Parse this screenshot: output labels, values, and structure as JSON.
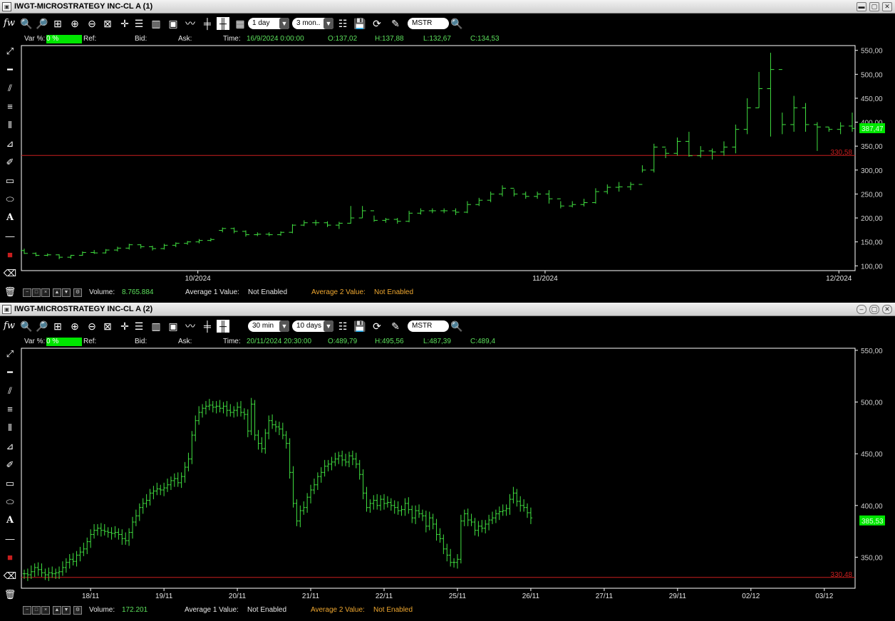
{
  "colors": {
    "bar": "#40e040",
    "price_line": "#c81e1e",
    "price_label": "#c81e1e",
    "last_box": "#00e600",
    "frame": "#ffffff"
  },
  "panes": [
    {
      "title": "IWGT-MICROSTRATEGY INC-CL A (1)",
      "toolbar": {
        "fw_label": "fw",
        "interval": "1 day",
        "range": "3 mon..",
        "symbol": "MSTR"
      },
      "info": {
        "var_label": "Var %:",
        "var_value": "0 %",
        "ref_label": "Ref:",
        "bid_label": "Bid:",
        "ask_label": "Ask:",
        "time_label": "Time:",
        "time_value": "16/9/2024 0:00:00",
        "open": "O:137,02",
        "high": "H:137,88",
        "low": "L:132,67",
        "close": "C:134,53"
      },
      "status": {
        "volume_label": "Volume:",
        "volume_value": "8.765.884",
        "avg1_label": "Average 1 Value:",
        "avg1_value": "Not Enabled",
        "avg2_label": "Average 2 Value:",
        "avg2_value": "Not Enabled"
      },
      "chart_data": {
        "type": "ohlc",
        "y_ticks": [
          "550,00",
          "500,00",
          "450,00",
          "400,00",
          "350,00",
          "300,00",
          "250,00",
          "200,00",
          "150,00",
          "100,00"
        ],
        "ylim": [
          90,
          560
        ],
        "x_labels": [
          "10/2024",
          "11/2024",
          "12/2024"
        ],
        "x_label_index": [
          13,
          39,
          61
        ],
        "x_count": 63,
        "price_line": {
          "value": 330.58,
          "label": "330,58"
        },
        "last_value": {
          "value": 387.47,
          "label": "387,47"
        },
        "bars": [
          [
            132,
            126,
            136,
            125
          ],
          [
            126,
            122,
            128,
            120
          ],
          [
            122,
            123,
            126,
            120
          ],
          [
            123,
            118,
            124,
            114
          ],
          [
            118,
            122,
            123,
            115
          ],
          [
            122,
            128,
            130,
            121
          ],
          [
            128,
            127,
            133,
            125
          ],
          [
            127,
            133,
            135,
            126
          ],
          [
            133,
            137,
            140,
            130
          ],
          [
            137,
            144,
            146,
            134
          ],
          [
            144,
            140,
            145,
            136
          ],
          [
            140,
            136,
            142,
            132
          ],
          [
            136,
            143,
            146,
            134
          ],
          [
            143,
            147,
            149,
            139
          ],
          [
            147,
            150,
            152,
            144
          ],
          [
            150,
            153,
            156,
            147
          ],
          [
            153,
            155,
            158,
            151
          ],
          [
            174,
            178,
            180,
            170
          ],
          [
            178,
            172,
            180,
            168
          ],
          [
            172,
            165,
            174,
            161
          ],
          [
            165,
            166,
            170,
            162
          ],
          [
            166,
            165,
            170,
            162
          ],
          [
            165,
            170,
            172,
            163
          ],
          [
            170,
            185,
            187,
            168
          ],
          [
            185,
            190,
            195,
            183
          ],
          [
            190,
            190,
            196,
            184
          ],
          [
            190,
            185,
            193,
            181
          ],
          [
            185,
            189,
            192,
            177
          ],
          [
            189,
            200,
            225,
            188
          ],
          [
            200,
            215,
            225,
            200
          ],
          [
            215,
            195,
            205,
            192
          ],
          [
            195,
            197,
            200,
            190
          ],
          [
            197,
            193,
            200,
            188
          ],
          [
            193,
            210,
            215,
            191
          ],
          [
            210,
            215,
            220,
            207
          ],
          [
            215,
            215,
            220,
            210
          ],
          [
            215,
            215,
            220,
            210
          ],
          [
            215,
            212,
            220,
            206
          ],
          [
            212,
            228,
            235,
            210
          ],
          [
            228,
            237,
            242,
            225
          ],
          [
            237,
            250,
            255,
            233
          ],
          [
            250,
            262,
            268,
            245
          ],
          [
            262,
            250,
            260,
            245
          ],
          [
            250,
            245,
            255,
            240
          ],
          [
            245,
            250,
            255,
            240
          ],
          [
            250,
            240,
            258,
            230
          ],
          [
            240,
            225,
            235,
            220
          ],
          [
            225,
            228,
            235,
            222
          ],
          [
            228,
            232,
            240,
            224
          ],
          [
            232,
            255,
            262,
            230
          ],
          [
            255,
            264,
            270,
            250
          ],
          [
            264,
            265,
            275,
            255
          ],
          [
            265,
            270,
            275,
            258
          ],
          [
            270,
            300,
            310,
            295
          ],
          [
            300,
            348,
            355,
            295
          ],
          [
            348,
            335,
            345,
            325
          ],
          [
            335,
            360,
            368,
            330
          ],
          [
            360,
            330,
            380,
            328
          ],
          [
            330,
            340,
            350,
            326
          ],
          [
            340,
            338,
            345,
            322
          ],
          [
            338,
            348,
            360,
            330
          ],
          [
            348,
            385,
            395,
            335
          ],
          [
            385,
            430,
            450,
            375
          ],
          [
            430,
            470,
            505,
            430
          ],
          [
            470,
            510,
            545,
            370
          ],
          [
            510,
            395,
            420,
            375
          ],
          [
            395,
            430,
            455,
            380
          ],
          [
            430,
            395,
            440,
            380
          ],
          [
            395,
            390,
            400,
            340
          ],
          [
            390,
            385,
            390,
            380
          ],
          [
            385,
            392,
            400,
            375
          ],
          [
            392,
            387,
            420,
            380
          ]
        ]
      }
    },
    {
      "title": "IWGT-MICROSTRATEGY INC-CL A (2)",
      "toolbar": {
        "fw_label": "fw",
        "interval": "30 min",
        "range": "10 days",
        "symbol": "MSTR"
      },
      "info": {
        "var_label": "Var %:",
        "var_value": "0 %",
        "ref_label": "Ref:",
        "bid_label": "Bid:",
        "ask_label": "Ask:",
        "time_label": "Time:",
        "time_value": "20/11/2024 20:30:00",
        "open": "O:489,79",
        "high": "H:495,56",
        "low": "L:487,39",
        "close": "C:489,4"
      },
      "status": {
        "volume_label": "Volume:",
        "volume_value": "172.201",
        "avg1_label": "Average 1 Value:",
        "avg1_value": "Not Enabled",
        "avg2_label": "Average 2 Value:",
        "avg2_value": "Not Enabled"
      },
      "chart_data": {
        "type": "ohlc",
        "y_ticks": [
          "550,00",
          "500,00",
          "450,00",
          "400,00",
          "350,00"
        ],
        "ylim": [
          320,
          552
        ],
        "x_labels": [
          "18/11",
          "19/11",
          "20/11",
          "21/11",
          "22/11",
          "25/11",
          "26/11",
          "27/11",
          "29/11",
          "02/12",
          "03/12"
        ],
        "x_label_index": [
          19,
          40,
          61,
          82,
          103,
          124,
          145,
          166,
          187,
          208,
          229
        ],
        "x_count": 238,
        "price_line": {
          "value": 330.48,
          "label": "330,48"
        },
        "last_value": {
          "value": 385.53,
          "label": "385,53"
        },
        "series": [
          334,
          333,
          336,
          340,
          338,
          335,
          333,
          335,
          334,
          335,
          336,
          340,
          345,
          348,
          346,
          352,
          355,
          358,
          365,
          372,
          376,
          378,
          376,
          375,
          374,
          373,
          374,
          372,
          368,
          366,
          374,
          384,
          390,
          398,
          402,
          405,
          412,
          414,
          416,
          415,
          417,
          420,
          424,
          426,
          422,
          428,
          437,
          445,
          468,
          482,
          490,
          494,
          496,
          497,
          495,
          496,
          494,
          496,
          492,
          490,
          492,
          495,
          490,
          488,
          472,
          498,
          468,
          460,
          455,
          470,
          482,
          478,
          476,
          474,
          468,
          460,
          432,
          402,
          385,
          395,
          398,
          408,
          415,
          420,
          428,
          432,
          438,
          440,
          442,
          445,
          448,
          444,
          442,
          448,
          445,
          440,
          430,
          412,
          398,
          402,
          405,
          400,
          406,
          402,
          403,
          400,
          398,
          395,
          396,
          402,
          396,
          388,
          395,
          392,
          390,
          380,
          388,
          382,
          372,
          368,
          358,
          352,
          345,
          345,
          348,
          385,
          392,
          386,
          384,
          376,
          380,
          378,
          382,
          386,
          388,
          392,
          394,
          395,
          397,
          406,
          412,
          404,
          400,
          398,
          393,
          388
        ]
      }
    }
  ],
  "left_tools": [
    "diagonal-line-tool",
    "horizontal-line-tool",
    "parallel-lines-tool",
    "fibonacci-tool",
    "vertical-lines-tool",
    "gann-tool",
    "pencil-tool",
    "rectangle-tool",
    "ellipse-tool",
    "text-tool",
    "line-weight-tool",
    "color-tool",
    "eraser-tool",
    "trash-tool"
  ]
}
